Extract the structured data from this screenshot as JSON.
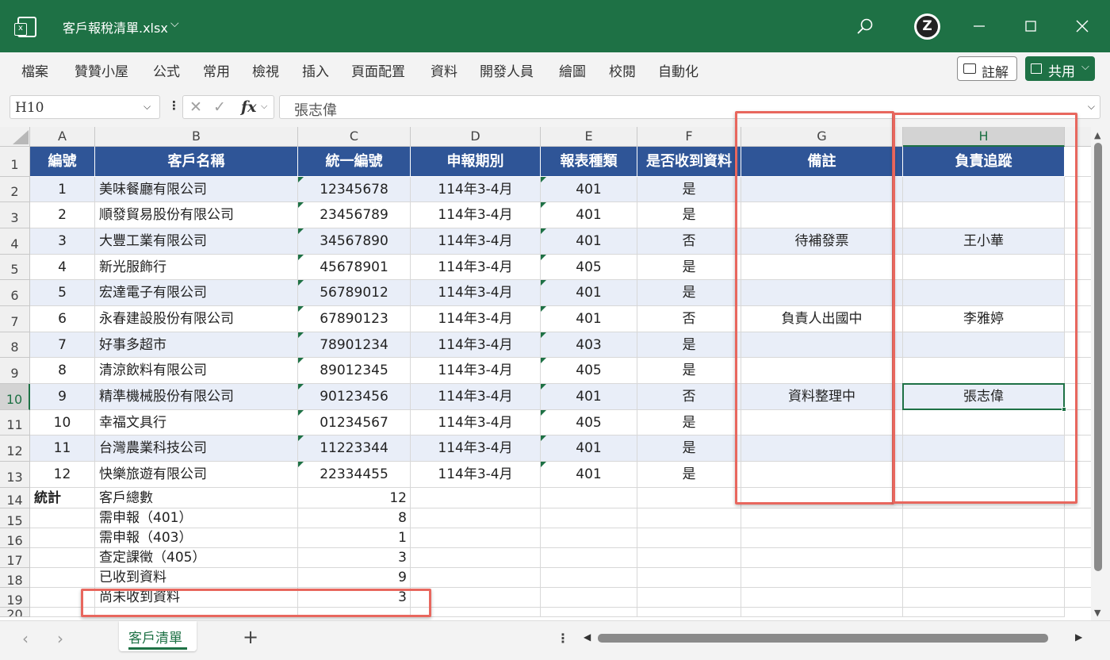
{
  "titlebar": {
    "file_name": "客戶報稅清單.xlsx",
    "title_chevron": "⌵",
    "icons": [
      "excel-app-icon",
      "search-icon",
      "user-avatar",
      "minimize-icon",
      "maximize-icon",
      "close-icon"
    ]
  },
  "ribbon": {
    "tabs": [
      "檔案",
      "贊贊小屋",
      "公式",
      "常用",
      "檢視",
      "插入",
      "頁面配置",
      "資料",
      "開發人員",
      "繪圖",
      "校閱",
      "自動化"
    ],
    "comment_label": "註解",
    "share_label": "共用"
  },
  "formula_bar": {
    "name_box": "H10",
    "fx": "fx",
    "cancel": "✕",
    "enter": "✓",
    "value": "張志偉"
  },
  "sheet": {
    "column_headers": [
      "A",
      "B",
      "C",
      "D",
      "E",
      "F",
      "G",
      "H"
    ],
    "selected_column": "H",
    "selected_row": "10",
    "table_header": [
      "編號",
      "客戶名稱",
      "統一編號",
      "申報期別",
      "報表種類",
      "是否收到資料",
      "備註",
      "負責追蹤"
    ],
    "rows": [
      {
        "row": "2",
        "cells": [
          "1",
          "美味餐廳有限公司",
          "12345678",
          "114年3-4月",
          "401",
          "是",
          "",
          ""
        ]
      },
      {
        "row": "3",
        "cells": [
          "2",
          "順發貿易股份有限公司",
          "23456789",
          "114年3-4月",
          "401",
          "是",
          "",
          ""
        ]
      },
      {
        "row": "4",
        "cells": [
          "3",
          "大豐工業有限公司",
          "34567890",
          "114年3-4月",
          "401",
          "否",
          "待補發票",
          "王小華"
        ]
      },
      {
        "row": "5",
        "cells": [
          "4",
          "新光服飾行",
          "45678901",
          "114年3-4月",
          "405",
          "是",
          "",
          ""
        ]
      },
      {
        "row": "6",
        "cells": [
          "5",
          "宏達電子有限公司",
          "56789012",
          "114年3-4月",
          "401",
          "是",
          "",
          ""
        ]
      },
      {
        "row": "7",
        "cells": [
          "6",
          "永春建設股份有限公司",
          "67890123",
          "114年3-4月",
          "401",
          "否",
          "負責人出國中",
          "李雅婷"
        ]
      },
      {
        "row": "8",
        "cells": [
          "7",
          "好事多超市",
          "78901234",
          "114年3-4月",
          "403",
          "是",
          "",
          ""
        ]
      },
      {
        "row": "9",
        "cells": [
          "8",
          "清涼飲料有限公司",
          "89012345",
          "114年3-4月",
          "405",
          "是",
          "",
          ""
        ]
      },
      {
        "row": "10",
        "cells": [
          "9",
          "精準機械股份有限公司",
          "90123456",
          "114年3-4月",
          "401",
          "否",
          "資料整理中",
          "張志偉"
        ]
      },
      {
        "row": "11",
        "cells": [
          "10",
          "幸福文具行",
          "01234567",
          "114年3-4月",
          "405",
          "是",
          "",
          ""
        ]
      },
      {
        "row": "12",
        "cells": [
          "11",
          "台灣農業科技公司",
          "11223344",
          "114年3-4月",
          "401",
          "是",
          "",
          ""
        ]
      },
      {
        "row": "13",
        "cells": [
          "12",
          "快樂旅遊有限公司",
          "22334455",
          "114年3-4月",
          "401",
          "是",
          "",
          ""
        ]
      }
    ],
    "summary": [
      {
        "row": "14",
        "a": "統計",
        "b": "客戶總數",
        "c": "12"
      },
      {
        "row": "15",
        "a": "",
        "b": "需申報（401）",
        "c": "8"
      },
      {
        "row": "16",
        "a": "",
        "b": "需申報（403）",
        "c": "1"
      },
      {
        "row": "17",
        "a": "",
        "b": "查定課徵（405）",
        "c": "3"
      },
      {
        "row": "18",
        "a": "",
        "b": "已收到資料",
        "c": "9"
      },
      {
        "row": "19",
        "a": "",
        "b": "尚未收到資料",
        "c": "3"
      }
    ],
    "partial_row": "20"
  },
  "bottom_bar": {
    "sheet_tab": "客戶清單",
    "add_sheet": "+",
    "prev": "‹",
    "next": "›"
  }
}
